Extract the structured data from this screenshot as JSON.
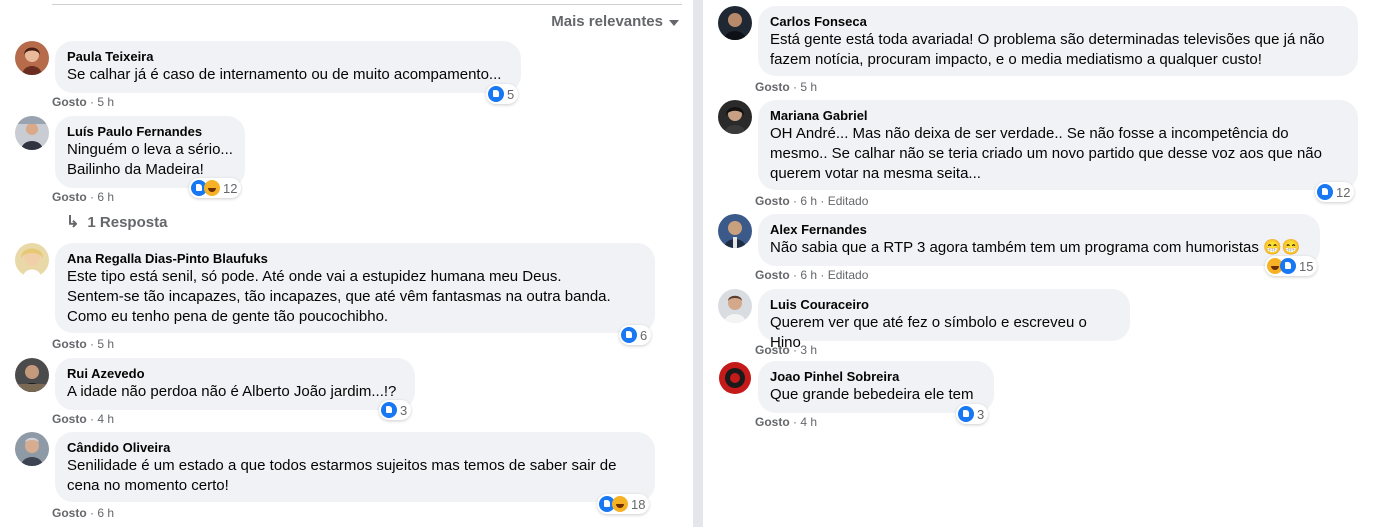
{
  "sort": {
    "label": "Mais relevantes"
  },
  "actions": {
    "like": "Gosto",
    "edited": "Editado"
  },
  "left": [
    {
      "name": "Paula Teixeira",
      "text": "Se calhar já é caso de internamento ou de muito acompamento...",
      "time": "5 h",
      "reactions": 5
    },
    {
      "name": "Luís Paulo Fernandes",
      "text": "Ninguém o leva a sério...\nBailinho da Madeira!",
      "time": "6 h",
      "reactions": 12,
      "replies": "1 Resposta"
    },
    {
      "name": "Ana Regalla Dias-Pinto Blaufuks",
      "text": "Este tipo está senil, só pode. Até onde vai a estupidez humana meu Deus.\nSentem-se tão incapazes, tão incapazes, que até vêm fantasmas na outra banda.\nComo eu tenho pena de gente tão poucochibho.",
      "time": "5 h",
      "reactions": 6
    },
    {
      "name": "Rui Azevedo",
      "text": "A idade não perdoa não é Alberto João jardim...!?",
      "time": "4 h",
      "reactions": 3
    },
    {
      "name": "Cândido Oliveira",
      "text": "Senilidade é um estado a que todos estarmos sujeitos mas temos de saber sair de\ncena no momento certo!",
      "time": "6 h",
      "reactions": 18
    }
  ],
  "right": [
    {
      "name": "Carlos Fonseca",
      "text": "Está gente está toda avariada! O problema são determinadas televisões que já não\nfazem notícia, procuram impacto, e o media mediatismo a qualquer custo!",
      "time": "5 h"
    },
    {
      "name": "Mariana Gabriel",
      "text": "OH André... Mas não deixa de ser verdade.. Se não fosse a incompetência do\nmesmo.. Se calhar não se teria criado um novo partido que desse voz aos que não\nquerem votar na mesma seita...",
      "time": "6 h",
      "reactions": 12
    },
    {
      "name": "Alex Fernandes",
      "text": "Não sabia que a RTP 3 agora também tem um programa com humoristas 😁😁",
      "time": "6 h",
      "reactions": 15
    },
    {
      "name": "Luis Couraceiro",
      "text": "Querem ver que até fez o símbolo e escreveu o Hino",
      "time": "3 h"
    },
    {
      "name": "Joao Pinhel Sobreira",
      "text": "Que grande bebedeira ele tem",
      "time": "4 h",
      "reactions": 3
    }
  ]
}
